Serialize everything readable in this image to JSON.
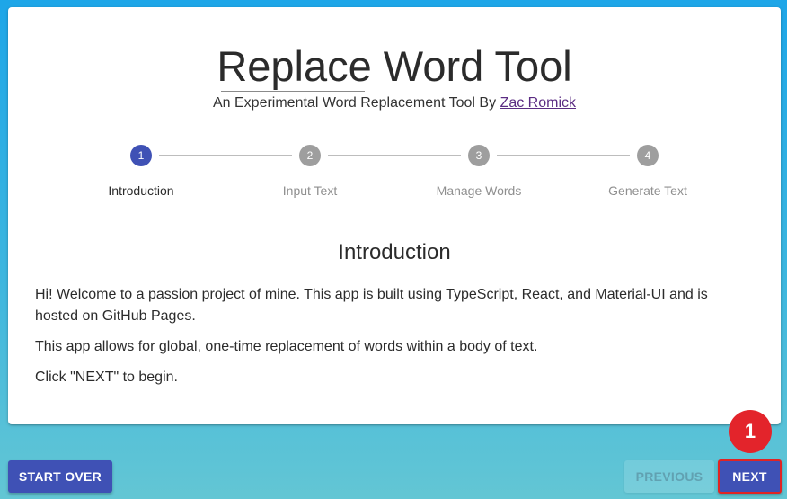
{
  "header": {
    "title": "Replace Word Tool",
    "subtitle_prefix": "An Experimental Word Replacement Tool By",
    "author_link": "Zac Romick"
  },
  "stepper": {
    "active_step": 1,
    "steps": [
      {
        "number": "1",
        "label": "Introduction"
      },
      {
        "number": "2",
        "label": "Input Text"
      },
      {
        "number": "3",
        "label": "Manage Words"
      },
      {
        "number": "4",
        "label": "Generate Text"
      }
    ]
  },
  "main": {
    "heading": "Introduction",
    "paragraphs": [
      "Hi! Welcome to a passion project of mine. This app is built using TypeScript, React, and Material-UI and is hosted on GitHub Pages.",
      "This app allows for global, one-time replacement of words within a body of text.",
      "Click \"NEXT\" to begin."
    ]
  },
  "footer": {
    "start_over_label": "START OVER",
    "previous_label": "PREVIOUS",
    "next_label": "NEXT"
  },
  "annotation": {
    "marker_label": "1"
  },
  "colors": {
    "primary": "#3f51b5",
    "inactive_step": "#9e9e9e",
    "link": "#5b2c83",
    "highlight": "#e02424"
  }
}
